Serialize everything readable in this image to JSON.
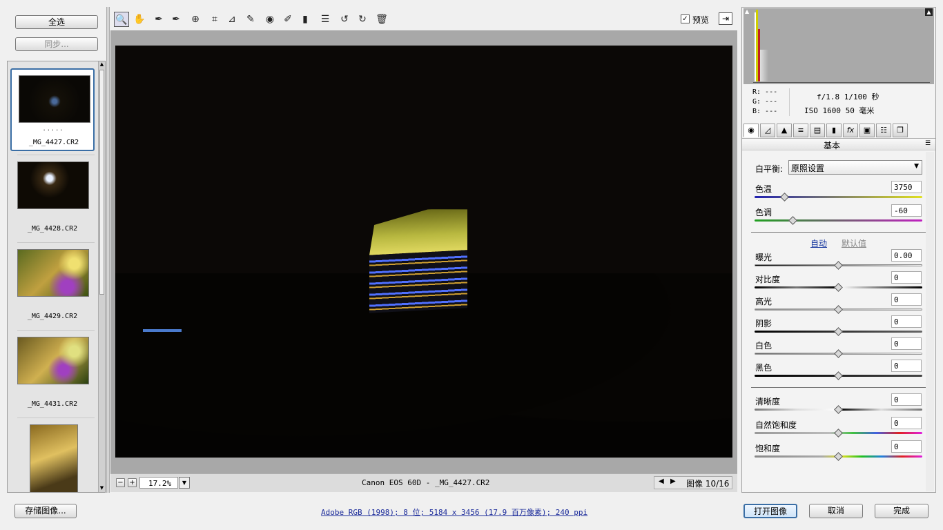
{
  "left": {
    "select_all": "全选",
    "sync": "同步...",
    "film": [
      {
        "dots": ".....",
        "name": "_MG_4427.CR2"
      },
      {
        "dots": "",
        "name": "_MG_4428.CR2"
      },
      {
        "dots": "",
        "name": "_MG_4429.CR2"
      },
      {
        "dots": "",
        "name": "_MG_4431.CR2"
      },
      {
        "dots": "",
        "name": ""
      }
    ]
  },
  "toolbar": {
    "tools": [
      "zoom-tool",
      "hand-tool",
      "white-balance-tool",
      "color-sampler-tool",
      "targeted-adjustment-tool",
      "crop-tool",
      "straighten-tool",
      "spot-removal-tool",
      "red-eye-tool",
      "adjustment-brush",
      "graduated-filter",
      "preferences",
      "rotate-ccw",
      "rotate-cw",
      "delete"
    ],
    "preview_label": "预览",
    "preview_checked": true
  },
  "status": {
    "zoom": "17.2%",
    "camera": "Canon EOS 60D -  _MG_4427.CR2",
    "image_counter": "图像 10/16"
  },
  "info": {
    "r": "R:  ---",
    "g": "G:  ---",
    "b": "B:  ---",
    "line1": "f/1.8  1/100 秒",
    "line2": "ISO 1600  50 毫米"
  },
  "panel": {
    "title": "基本",
    "tabs": [
      "basic",
      "tone-curve",
      "detail",
      "hsl",
      "split-toning",
      "lens",
      "fx",
      "camera-calibration",
      "presets",
      "snapshots"
    ],
    "wb_label": "白平衡:",
    "wb_value": "原照设置",
    "temp_label": "色温",
    "temp_value": "3750",
    "tint_label": "色调",
    "tint_value": "-60",
    "auto": "自动",
    "default": "默认值",
    "exposure_label": "曝光",
    "exposure_value": "0.00",
    "contrast_label": "对比度",
    "contrast_value": "0",
    "highlights_label": "高光",
    "highlights_value": "0",
    "shadows_label": "阴影",
    "shadows_value": "0",
    "whites_label": "白色",
    "whites_value": "0",
    "blacks_label": "黑色",
    "blacks_value": "0",
    "clarity_label": "清晰度",
    "clarity_value": "0",
    "vibrance_label": "自然饱和度",
    "vibrance_value": "0",
    "saturation_label": "饱和度",
    "saturation_value": "0"
  },
  "bottom": {
    "save": "存储图像...",
    "workflow": "Adobe RGB (1998); 8 位; 5184 x 3456 (17.9 百万像素); 240 ppi",
    "open": "打开图像",
    "cancel": "取消",
    "done": "完成"
  }
}
